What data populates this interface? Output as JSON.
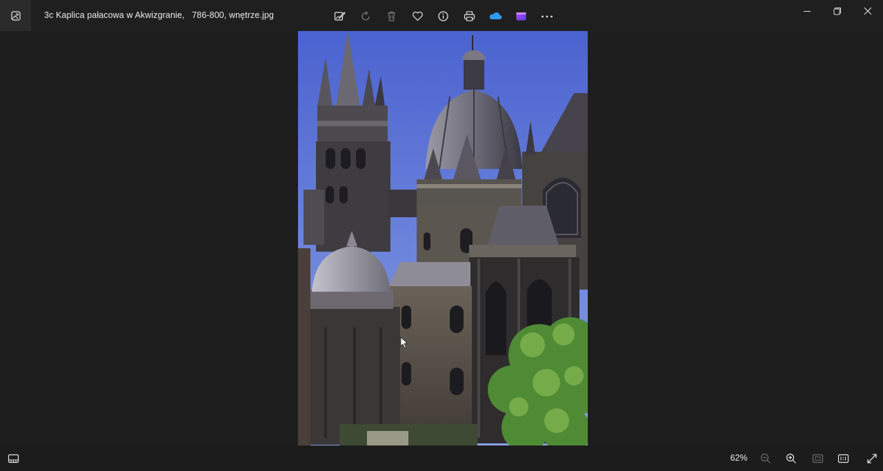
{
  "window": {
    "title": "3c Kaplica pałacowa w Akwizgranie,   786-800, wnętrze.jpg"
  },
  "toolbar": {
    "items": [
      {
        "icon": "edit-image-icon",
        "label": "Edit image"
      },
      {
        "icon": "rotate-icon",
        "label": "Rotate"
      },
      {
        "icon": "delete-icon",
        "label": "Delete"
      },
      {
        "icon": "favorite-icon",
        "label": "Add to favorites"
      },
      {
        "icon": "info-icon",
        "label": "File information"
      },
      {
        "icon": "print-icon",
        "label": "Print"
      },
      {
        "icon": "onedrive-icon",
        "label": "OneDrive"
      },
      {
        "icon": "clipchamp-icon",
        "label": "Edit with Clipchamp"
      },
      {
        "icon": "more-icon",
        "label": "See more"
      }
    ]
  },
  "window_controls": [
    "minimize-icon",
    "restore-icon",
    "close-icon"
  ],
  "viewer": {
    "zoom": "62%"
  },
  "colors": {
    "background": "#1f1f1f",
    "bottombar": "#1c1c1c",
    "sky": "#5a71d4",
    "onedrive": "#2f9af0",
    "clipchamp": "#8a4cf0"
  }
}
